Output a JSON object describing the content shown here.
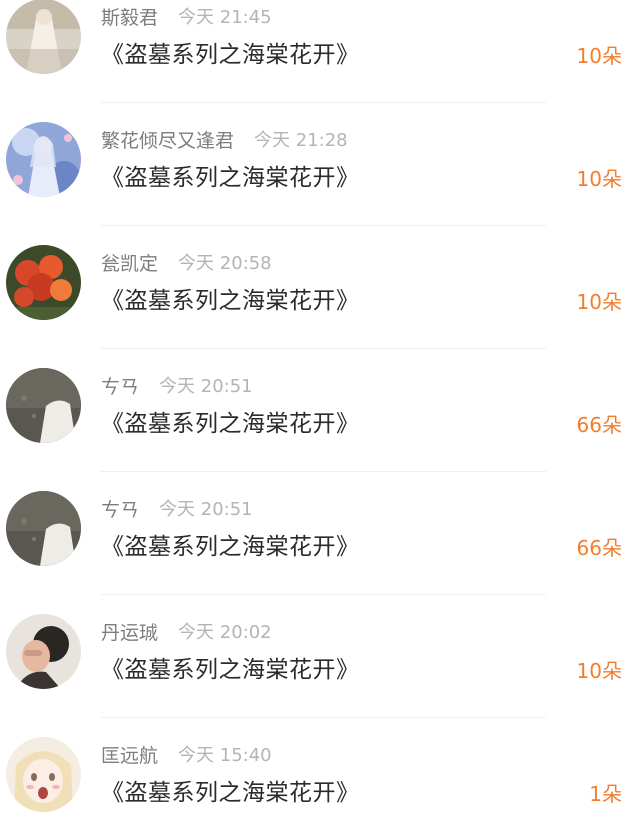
{
  "gift_list": [
    {
      "username": "斯毅君",
      "time": "今天 21:45",
      "title": "《盗墓系列之海棠花开》",
      "count": "10朵"
    },
    {
      "username": "繁花倾尽又逢君",
      "time": "今天 21:28",
      "title": "《盗墓系列之海棠花开》",
      "count": "10朵"
    },
    {
      "username": "瓮凯定",
      "time": "今天 20:58",
      "title": "《盗墓系列之海棠花开》",
      "count": "10朵"
    },
    {
      "username": "ㄘㄢ",
      "time": "今天 20:51",
      "title": "《盗墓系列之海棠花开》",
      "count": "66朵"
    },
    {
      "username": "ㄘㄢ",
      "time": "今天 20:51",
      "title": "《盗墓系列之海棠花开》",
      "count": "66朵"
    },
    {
      "username": "丹运珹",
      "time": "今天 20:02",
      "title": "《盗墓系列之海棠花开》",
      "count": "10朵"
    },
    {
      "username": "匡远航",
      "time": "今天 15:40",
      "title": "《盗墓系列之海棠花开》",
      "count": "1朵"
    }
  ],
  "colors": {
    "username": "#7d7d7d",
    "time": "#b4b4b4",
    "title": "#2b2b2b",
    "count": "#f47c2c",
    "divider": "#efefef"
  }
}
